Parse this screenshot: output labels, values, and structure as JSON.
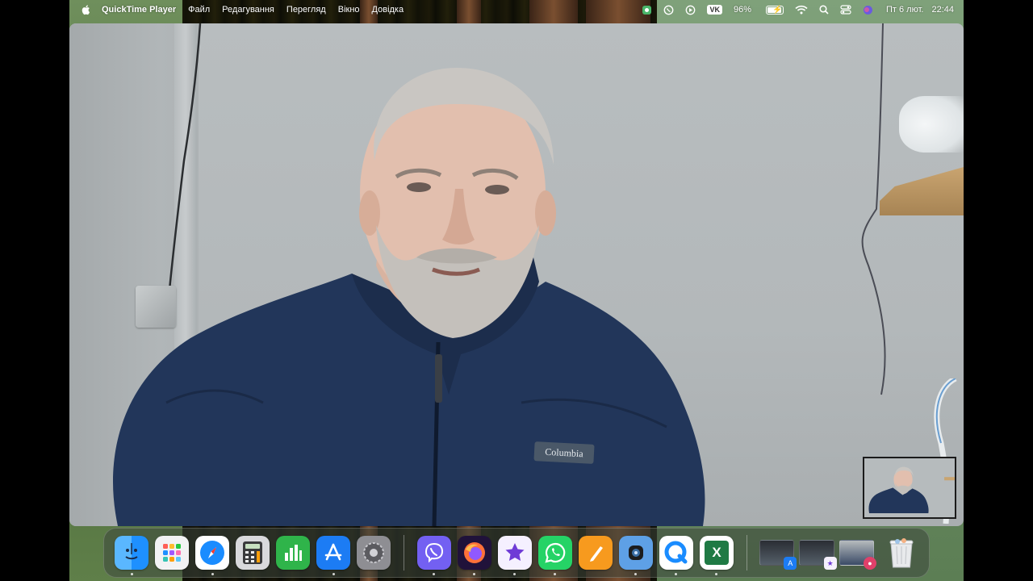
{
  "menubar": {
    "app_name": "QuickTime Player",
    "menus": [
      "Файл",
      "Редагування",
      "Перегляд",
      "Вікно",
      "Довідка"
    ],
    "vk_label": "VK",
    "battery_percent": "96%",
    "battery_level": 0.96,
    "date": "Пт 6 лют.",
    "time": "22:44"
  },
  "video": {
    "brand_patch": "Columbia"
  },
  "dock": {
    "apps": [
      {
        "name": "Finder",
        "icon": "finder-icon",
        "running": true
      },
      {
        "name": "Launchpad",
        "icon": "launchpad-icon",
        "running": false
      },
      {
        "name": "Safari",
        "icon": "safari-icon",
        "running": true
      },
      {
        "name": "Calculator",
        "icon": "calculator-icon",
        "running": false
      },
      {
        "name": "Numbers",
        "icon": "numbers-icon",
        "running": false
      },
      {
        "name": "App Store",
        "icon": "app-store-icon",
        "running": true
      },
      {
        "name": "System Settings",
        "icon": "settings-icon",
        "running": false
      },
      {
        "name": "Viber",
        "icon": "viber-icon",
        "running": true
      },
      {
        "name": "Firefox",
        "icon": "firefox-icon",
        "running": true
      },
      {
        "name": "iMovie",
        "icon": "imovie-icon",
        "running": true
      },
      {
        "name": "WhatsApp",
        "icon": "whatsapp-icon",
        "running": true
      },
      {
        "name": "Pages",
        "icon": "pages-icon",
        "running": false
      },
      {
        "name": "Photo Booth",
        "icon": "photo-booth-icon",
        "running": true
      },
      {
        "name": "QuickTime Player",
        "icon": "quicktime-icon",
        "running": true
      },
      {
        "name": "Excel",
        "icon": "excel-icon",
        "running": true
      }
    ],
    "excel_letter": "X",
    "colors": {
      "finder": "#1e90ff",
      "safari": "#1a8cff",
      "numbers": "#2fb44a",
      "app_store": "#1c7cf4",
      "viber": "#7360f2",
      "whatsapp": "#25d366",
      "pages": "#f79a1e",
      "excel": "#1f7a44"
    }
  }
}
